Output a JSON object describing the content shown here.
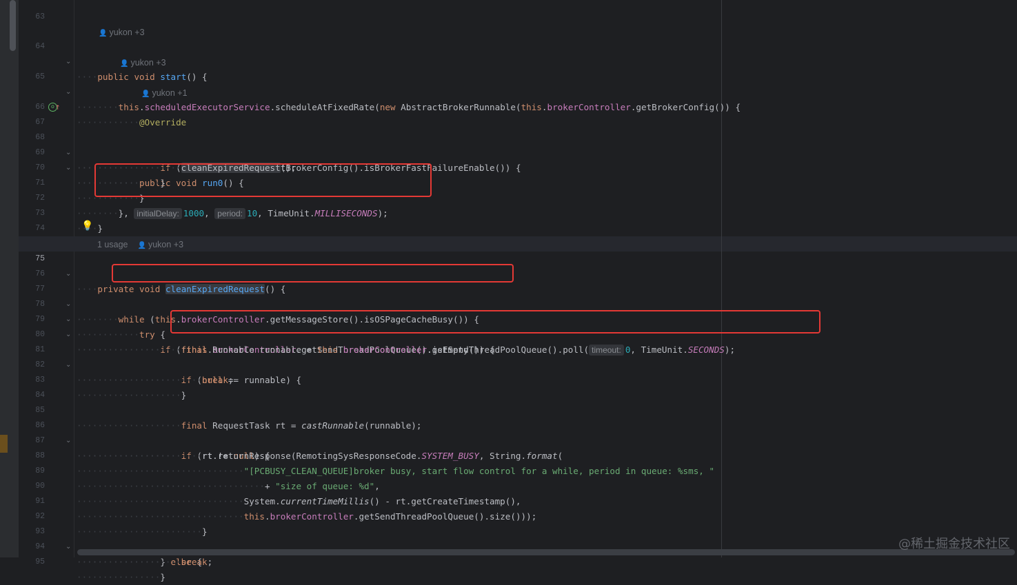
{
  "watermark": "@稀土掘金技术社区",
  "lens": {
    "l64": "yukon +3",
    "l65": "yukon +3",
    "l66": "yukon +1",
    "l75_usage": "1 usage",
    "l75_author": "yukon +3"
  },
  "line_numbers": [
    "63",
    "64",
    "65",
    "66",
    "67",
    "68",
    "69",
    "70",
    "71",
    "72",
    "73",
    "74",
    "75",
    "76",
    "77",
    "78",
    "79",
    "80",
    "81",
    "82",
    "83",
    "84",
    "85",
    "86",
    "87",
    "88",
    "89",
    "90",
    "91",
    "92",
    "93",
    "94",
    "95"
  ],
  "code": {
    "l64": [
      "public",
      " ",
      "void",
      " ",
      "start",
      "() {"
    ],
    "l65": [
      "this",
      ".",
      "scheduledExecutorService",
      ".scheduleAtFixedRate(",
      "new",
      " AbstractBrokerRunnable(",
      "this",
      ".",
      "brokerController",
      ".getBrokerConfig()) {"
    ],
    "l66": "@Override",
    "l67": [
      "public",
      " ",
      "void",
      " ",
      "run0",
      "() {"
    ],
    "l68": [
      "if",
      " (",
      "brokerController",
      ".getBrokerConfig().isBrokerFastFailureEnable()) {"
    ],
    "l69": [
      "cleanExpiredRequest",
      "();"
    ],
    "l70": "}",
    "l71": "}",
    "l72": [
      "}, ",
      "initialDelay:",
      "1000",
      ", ",
      "period:",
      "10",
      ", TimeUnit.",
      "MILLISECONDS",
      ");"
    ],
    "l73": "}",
    "l75": [
      "private",
      " ",
      "void",
      " ",
      "cleanExpiredRequest",
      "() {"
    ],
    "l77": [
      "while",
      " (",
      "this",
      ".",
      "brokerController",
      ".getMessageStore().isOSPageCacheBusy()) {"
    ],
    "l78": [
      "try",
      " {"
    ],
    "l79": [
      "if",
      " (!",
      "this",
      ".",
      "brokerController",
      ".getSendThreadPoolQueue().isEmpty()) {"
    ],
    "l80": [
      "final",
      " Runnable runnable = ",
      "this",
      ".",
      "brokerController",
      ".getSendThreadPoolQueue().poll(",
      "timeout:",
      "0",
      ", TimeUnit.",
      "SECONDS",
      ");"
    ],
    "l81": [
      "if",
      " (",
      "null",
      " == runnable) {"
    ],
    "l82": [
      "break",
      ";"
    ],
    "l83": "}",
    "l85": [
      "final",
      " RequestTask rt = ",
      "castRunnable",
      "(runnable);"
    ],
    "l86": [
      "if",
      " (rt != ",
      "null",
      ") {"
    ],
    "l87": [
      "rt.returnResponse(RemotingSysResponseCode.",
      "SYSTEM_BUSY",
      ", String.",
      "format",
      "("
    ],
    "l88": "\"[PCBUSY_CLEAN_QUEUE]broker busy, start flow control for a while, period in queue: %sms, \"",
    "l89": [
      "+ ",
      "\"size of queue: %d\"",
      ","
    ],
    "l90": [
      "System.",
      "currentTimeMillis",
      "() - rt.getCreateTimestamp(),"
    ],
    "l91": [
      "this",
      ".",
      "brokerController",
      ".getSendThreadPoolQueue().size()));"
    ],
    "l92": "}",
    "l93": [
      "}",
      " ",
      "else",
      " {"
    ],
    "l94": [
      "break",
      ";"
    ],
    "l95": "}"
  },
  "colors": {
    "highlight_box": "#e53935",
    "keyword": "#cf8e6d",
    "function": "#56a8f5",
    "field": "#c77dbb",
    "number": "#2aacb8",
    "string": "#6aab73",
    "annotation": "#b3ae60"
  },
  "icons": [
    "user-icon",
    "lightbulb-icon",
    "override-gutter-icon",
    "fold-chevron-icon"
  ]
}
